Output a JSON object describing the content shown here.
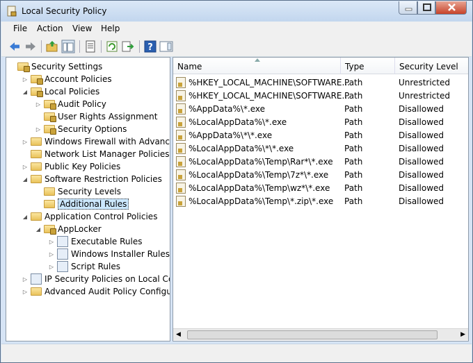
{
  "window": {
    "title": "Local Security Policy"
  },
  "menu": [
    "File",
    "Action",
    "View",
    "Help"
  ],
  "tree": {
    "items": [
      {
        "label": "Security Settings",
        "indent": 0,
        "arrow": "",
        "icon": "settings"
      },
      {
        "label": "Account Policies",
        "indent": 1,
        "arrow": "▷",
        "icon": "folder-lock"
      },
      {
        "label": "Local Policies",
        "indent": 1,
        "arrow": "◢",
        "icon": "folder-lock"
      },
      {
        "label": "Audit Policy",
        "indent": 2,
        "arrow": "▷",
        "icon": "folder-lock"
      },
      {
        "label": "User Rights Assignment",
        "indent": 2,
        "arrow": "",
        "icon": "folder-lock"
      },
      {
        "label": "Security Options",
        "indent": 2,
        "arrow": "▷",
        "icon": "folder-lock"
      },
      {
        "label": "Windows Firewall with Advanced Se",
        "indent": 1,
        "arrow": "▷",
        "icon": "folder"
      },
      {
        "label": "Network List Manager Policies",
        "indent": 1,
        "arrow": "",
        "icon": "folder"
      },
      {
        "label": "Public Key Policies",
        "indent": 1,
        "arrow": "▷",
        "icon": "folder"
      },
      {
        "label": "Software Restriction Policies",
        "indent": 1,
        "arrow": "◢",
        "icon": "folder"
      },
      {
        "label": "Security Levels",
        "indent": 2,
        "arrow": "",
        "icon": "folder"
      },
      {
        "label": "Additional Rules",
        "indent": 2,
        "arrow": "",
        "icon": "folder",
        "selected": true
      },
      {
        "label": "Application Control Policies",
        "indent": 1,
        "arrow": "◢",
        "icon": "folder"
      },
      {
        "label": "AppLocker",
        "indent": 2,
        "arrow": "◢",
        "icon": "applocker"
      },
      {
        "label": "Executable Rules",
        "indent": 3,
        "arrow": "▷",
        "icon": "generic"
      },
      {
        "label": "Windows Installer Rules",
        "indent": 3,
        "arrow": "▷",
        "icon": "generic"
      },
      {
        "label": "Script Rules",
        "indent": 3,
        "arrow": "▷",
        "icon": "generic"
      },
      {
        "label": "IP Security Policies on Local Compu",
        "indent": 1,
        "arrow": "▷",
        "icon": "generic"
      },
      {
        "label": "Advanced Audit Policy Configuratic",
        "indent": 1,
        "arrow": "▷",
        "icon": "folder"
      }
    ]
  },
  "list": {
    "columns": [
      "Name",
      "Type",
      "Security Level"
    ],
    "rows": [
      [
        "%HKEY_LOCAL_MACHINE\\SOFTWARE...",
        "Path",
        "Unrestricted"
      ],
      [
        "%HKEY_LOCAL_MACHINE\\SOFTWARE...",
        "Path",
        "Unrestricted"
      ],
      [
        "%AppData%\\*.exe",
        "Path",
        "Disallowed"
      ],
      [
        "%LocalAppData%\\*.exe",
        "Path",
        "Disallowed"
      ],
      [
        "%AppData%\\*\\*.exe",
        "Path",
        "Disallowed"
      ],
      [
        "%LocalAppData%\\*\\*.exe",
        "Path",
        "Disallowed"
      ],
      [
        "%LocalAppData%\\Temp\\Rar*\\*.exe",
        "Path",
        "Disallowed"
      ],
      [
        "%LocalAppData%\\Temp\\7z*\\*.exe",
        "Path",
        "Disallowed"
      ],
      [
        "%LocalAppData%\\Temp\\wz*\\*.exe",
        "Path",
        "Disallowed"
      ],
      [
        "%LocalAppData%\\Temp\\*.zip\\*.exe",
        "Path",
        "Disallowed"
      ]
    ]
  },
  "toolbar": [
    "back-arrow-icon",
    "forward-arrow-icon",
    "up-folder-icon",
    "show-hide-tree-icon",
    "properties-icon",
    "refresh-icon",
    "export-list-icon",
    "help-icon",
    "show-hide-action-pane-icon"
  ]
}
